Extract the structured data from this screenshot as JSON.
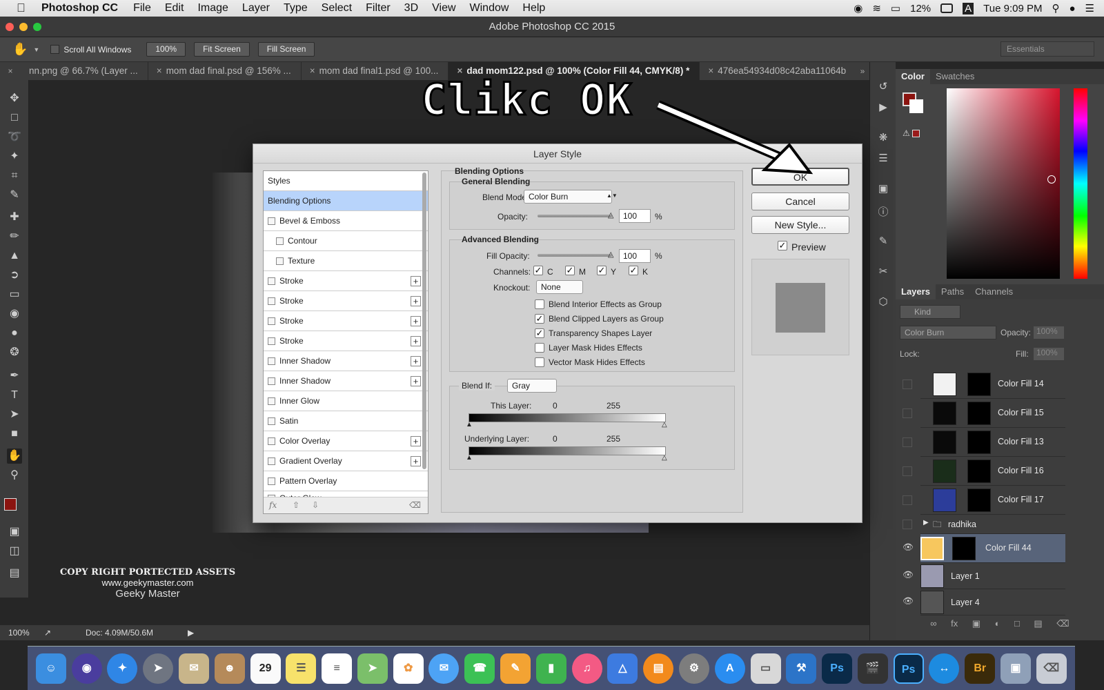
{
  "menubar": {
    "app": "Photoshop CC",
    "items": [
      "File",
      "Edit",
      "Image",
      "Layer",
      "Type",
      "Select",
      "Filter",
      "3D",
      "View",
      "Window",
      "Help"
    ],
    "battery": "12%",
    "user": "A",
    "clock": "Tue 9:09 PM"
  },
  "window": {
    "title": "Adobe Photoshop CC 2015"
  },
  "options": {
    "scroll_all": "Scroll All Windows",
    "zoom_btn": "100%",
    "fit_btn": "Fit Screen",
    "fill_btn": "Fill Screen",
    "workspace": "Essentials"
  },
  "tabs": [
    "nn.png @ 66.7% (Layer ...",
    "mom dad final.psd @ 156% ...",
    "mom dad final1.psd @ 100...",
    "dad mom122.psd @ 100% (Color Fill 44, CMYK/8) *",
    "476ea54934d08c42aba11064b"
  ],
  "status": {
    "zoom": "100%",
    "doc": "Doc: 4.09M/50.6M"
  },
  "annotation": "Clikc OK",
  "watermark": {
    "line1": "COPY RIGHT PORTECTED ASSETS",
    "line2": "www.geekymaster.com",
    "line3": "Geeky Master"
  },
  "dialog": {
    "title": "Layer Style",
    "styles": [
      "Styles",
      "Blending Options",
      "Bevel & Emboss",
      "Contour",
      "Texture",
      "Stroke",
      "Stroke",
      "Stroke",
      "Stroke",
      "Inner Shadow",
      "Inner Shadow",
      "Inner Glow",
      "Satin",
      "Color Overlay",
      "Gradient Overlay",
      "Pattern Overlay",
      "Outer Glow"
    ],
    "blending": {
      "section": "Blending Options",
      "general": "General Blending",
      "blend_mode_label": "Blend Mode:",
      "blend_mode": "Color Burn",
      "opacity_label": "Opacity:",
      "opacity": "100",
      "pct": "%",
      "advanced": "Advanced Blending",
      "fill_label": "Fill Opacity:",
      "fill": "100",
      "channels_label": "Channels:",
      "ch_c": "C",
      "ch_m": "M",
      "ch_y": "Y",
      "ch_k": "K",
      "knockout_label": "Knockout:",
      "knockout": "None",
      "opt1": "Blend Interior Effects as Group",
      "opt2": "Blend Clipped Layers as Group",
      "opt3": "Transparency Shapes Layer",
      "opt4": "Layer Mask Hides Effects",
      "opt5": "Vector Mask Hides Effects",
      "blendif_label": "Blend If:",
      "blendif": "Gray",
      "this_layer": "This Layer:",
      "under_layer": "Underlying Layer:",
      "lo": "0",
      "hi": "255"
    },
    "buttons": {
      "ok": "OK",
      "cancel": "Cancel",
      "new_style": "New Style...",
      "preview": "Preview"
    }
  },
  "color_panel": {
    "tab1": "Color",
    "tab2": "Swatches"
  },
  "layers_panel": {
    "tab1": "Layers",
    "tab2": "Paths",
    "tab3": "Channels",
    "kind": "Kind",
    "mode": "Color Burn",
    "opacity_label": "Opacity:",
    "opacity": "100%",
    "lock_label": "Lock:",
    "fill_label": "Fill:",
    "fill": "100%",
    "layers": [
      "Color Fill 14",
      "Color Fill 15",
      "Color Fill 13",
      "Color Fill 16",
      "Color Fill 17",
      "radhika",
      "Color Fill 44",
      "Layer 1",
      "Layer 4"
    ]
  },
  "dock": [
    "Finder",
    "Siri",
    "Safari",
    "Launchpad",
    "Mail",
    "Contacts",
    "29",
    "Notes",
    "Reminders",
    "Maps",
    "Photos",
    "Messages",
    "FaceTime",
    "Pages",
    "Numbers",
    "iTunes",
    "Keynote",
    "iBooks",
    "System Preferences",
    "App Store",
    "Preview",
    "Xcode",
    "Ps",
    "Final Cut",
    "Ps",
    "TeamViewer",
    "Br",
    "Image Capture",
    "Trash"
  ]
}
